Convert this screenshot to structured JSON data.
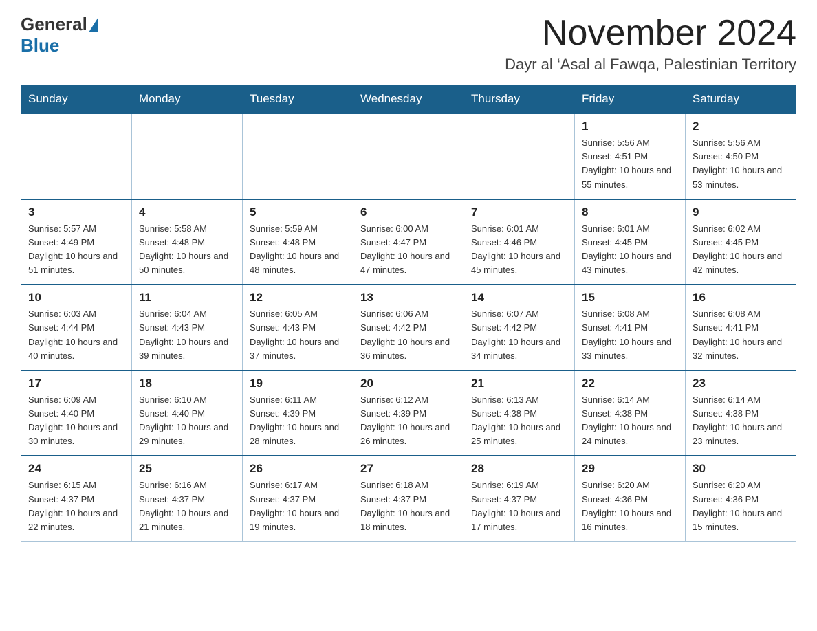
{
  "header": {
    "logo_general": "General",
    "logo_blue": "Blue",
    "title": "November 2024",
    "subtitle": "Dayr al ‘Asal al Fawqa, Palestinian Territory"
  },
  "weekdays": [
    "Sunday",
    "Monday",
    "Tuesday",
    "Wednesday",
    "Thursday",
    "Friday",
    "Saturday"
  ],
  "weeks": [
    [
      {
        "day": "",
        "sunrise": "",
        "sunset": "",
        "daylight": ""
      },
      {
        "day": "",
        "sunrise": "",
        "sunset": "",
        "daylight": ""
      },
      {
        "day": "",
        "sunrise": "",
        "sunset": "",
        "daylight": ""
      },
      {
        "day": "",
        "sunrise": "",
        "sunset": "",
        "daylight": ""
      },
      {
        "day": "",
        "sunrise": "",
        "sunset": "",
        "daylight": ""
      },
      {
        "day": "1",
        "sunrise": "Sunrise: 5:56 AM",
        "sunset": "Sunset: 4:51 PM",
        "daylight": "Daylight: 10 hours and 55 minutes."
      },
      {
        "day": "2",
        "sunrise": "Sunrise: 5:56 AM",
        "sunset": "Sunset: 4:50 PM",
        "daylight": "Daylight: 10 hours and 53 minutes."
      }
    ],
    [
      {
        "day": "3",
        "sunrise": "Sunrise: 5:57 AM",
        "sunset": "Sunset: 4:49 PM",
        "daylight": "Daylight: 10 hours and 51 minutes."
      },
      {
        "day": "4",
        "sunrise": "Sunrise: 5:58 AM",
        "sunset": "Sunset: 4:48 PM",
        "daylight": "Daylight: 10 hours and 50 minutes."
      },
      {
        "day": "5",
        "sunrise": "Sunrise: 5:59 AM",
        "sunset": "Sunset: 4:48 PM",
        "daylight": "Daylight: 10 hours and 48 minutes."
      },
      {
        "day": "6",
        "sunrise": "Sunrise: 6:00 AM",
        "sunset": "Sunset: 4:47 PM",
        "daylight": "Daylight: 10 hours and 47 minutes."
      },
      {
        "day": "7",
        "sunrise": "Sunrise: 6:01 AM",
        "sunset": "Sunset: 4:46 PM",
        "daylight": "Daylight: 10 hours and 45 minutes."
      },
      {
        "day": "8",
        "sunrise": "Sunrise: 6:01 AM",
        "sunset": "Sunset: 4:45 PM",
        "daylight": "Daylight: 10 hours and 43 minutes."
      },
      {
        "day": "9",
        "sunrise": "Sunrise: 6:02 AM",
        "sunset": "Sunset: 4:45 PM",
        "daylight": "Daylight: 10 hours and 42 minutes."
      }
    ],
    [
      {
        "day": "10",
        "sunrise": "Sunrise: 6:03 AM",
        "sunset": "Sunset: 4:44 PM",
        "daylight": "Daylight: 10 hours and 40 minutes."
      },
      {
        "day": "11",
        "sunrise": "Sunrise: 6:04 AM",
        "sunset": "Sunset: 4:43 PM",
        "daylight": "Daylight: 10 hours and 39 minutes."
      },
      {
        "day": "12",
        "sunrise": "Sunrise: 6:05 AM",
        "sunset": "Sunset: 4:43 PM",
        "daylight": "Daylight: 10 hours and 37 minutes."
      },
      {
        "day": "13",
        "sunrise": "Sunrise: 6:06 AM",
        "sunset": "Sunset: 4:42 PM",
        "daylight": "Daylight: 10 hours and 36 minutes."
      },
      {
        "day": "14",
        "sunrise": "Sunrise: 6:07 AM",
        "sunset": "Sunset: 4:42 PM",
        "daylight": "Daylight: 10 hours and 34 minutes."
      },
      {
        "day": "15",
        "sunrise": "Sunrise: 6:08 AM",
        "sunset": "Sunset: 4:41 PM",
        "daylight": "Daylight: 10 hours and 33 minutes."
      },
      {
        "day": "16",
        "sunrise": "Sunrise: 6:08 AM",
        "sunset": "Sunset: 4:41 PM",
        "daylight": "Daylight: 10 hours and 32 minutes."
      }
    ],
    [
      {
        "day": "17",
        "sunrise": "Sunrise: 6:09 AM",
        "sunset": "Sunset: 4:40 PM",
        "daylight": "Daylight: 10 hours and 30 minutes."
      },
      {
        "day": "18",
        "sunrise": "Sunrise: 6:10 AM",
        "sunset": "Sunset: 4:40 PM",
        "daylight": "Daylight: 10 hours and 29 minutes."
      },
      {
        "day": "19",
        "sunrise": "Sunrise: 6:11 AM",
        "sunset": "Sunset: 4:39 PM",
        "daylight": "Daylight: 10 hours and 28 minutes."
      },
      {
        "day": "20",
        "sunrise": "Sunrise: 6:12 AM",
        "sunset": "Sunset: 4:39 PM",
        "daylight": "Daylight: 10 hours and 26 minutes."
      },
      {
        "day": "21",
        "sunrise": "Sunrise: 6:13 AM",
        "sunset": "Sunset: 4:38 PM",
        "daylight": "Daylight: 10 hours and 25 minutes."
      },
      {
        "day": "22",
        "sunrise": "Sunrise: 6:14 AM",
        "sunset": "Sunset: 4:38 PM",
        "daylight": "Daylight: 10 hours and 24 minutes."
      },
      {
        "day": "23",
        "sunrise": "Sunrise: 6:14 AM",
        "sunset": "Sunset: 4:38 PM",
        "daylight": "Daylight: 10 hours and 23 minutes."
      }
    ],
    [
      {
        "day": "24",
        "sunrise": "Sunrise: 6:15 AM",
        "sunset": "Sunset: 4:37 PM",
        "daylight": "Daylight: 10 hours and 22 minutes."
      },
      {
        "day": "25",
        "sunrise": "Sunrise: 6:16 AM",
        "sunset": "Sunset: 4:37 PM",
        "daylight": "Daylight: 10 hours and 21 minutes."
      },
      {
        "day": "26",
        "sunrise": "Sunrise: 6:17 AM",
        "sunset": "Sunset: 4:37 PM",
        "daylight": "Daylight: 10 hours and 19 minutes."
      },
      {
        "day": "27",
        "sunrise": "Sunrise: 6:18 AM",
        "sunset": "Sunset: 4:37 PM",
        "daylight": "Daylight: 10 hours and 18 minutes."
      },
      {
        "day": "28",
        "sunrise": "Sunrise: 6:19 AM",
        "sunset": "Sunset: 4:37 PM",
        "daylight": "Daylight: 10 hours and 17 minutes."
      },
      {
        "day": "29",
        "sunrise": "Sunrise: 6:20 AM",
        "sunset": "Sunset: 4:36 PM",
        "daylight": "Daylight: 10 hours and 16 minutes."
      },
      {
        "day": "30",
        "sunrise": "Sunrise: 6:20 AM",
        "sunset": "Sunset: 4:36 PM",
        "daylight": "Daylight: 10 hours and 15 minutes."
      }
    ]
  ]
}
